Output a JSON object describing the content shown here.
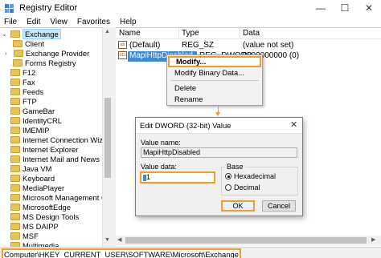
{
  "window": {
    "title": "Registry Editor",
    "minimize": "—",
    "maximize": "☐",
    "close": "✕"
  },
  "menu": [
    "File",
    "Edit",
    "View",
    "Favorites",
    "Help"
  ],
  "tree": {
    "selected": "Exchange",
    "children": [
      "Client",
      "Exchange Provider",
      "Forms Registry"
    ],
    "siblings": [
      "F12",
      "Fax",
      "Feeds",
      "FTP",
      "GameBar",
      "IdentityCRL",
      "IMEMIP",
      "Internet Connection Wizard",
      "Internet Explorer",
      "Internet Mail and News",
      "Java VM",
      "Keyboard",
      "MediaPlayer",
      "Microsoft Management Console",
      "MicrosoftEdge",
      "MS Design Tools",
      "MS DAIPP",
      "MSF",
      "Multimedia"
    ]
  },
  "list": {
    "columns": [
      "Name",
      "Type",
      "Data"
    ],
    "rows": [
      {
        "icon": "string-value-icon",
        "name": "(Default)",
        "type": "REG_SZ",
        "data": "(value not set)"
      },
      {
        "icon": "dword-value-icon",
        "name": "MapiHttpDisabled",
        "type": "REG_DWORD",
        "data": "0x00000000 (0)"
      }
    ]
  },
  "context_menu": {
    "items": [
      "Modify...",
      "Modify Binary Data...",
      "Delete",
      "Rename"
    ]
  },
  "dialog": {
    "title": "Edit DWORD (32-bit) Value",
    "close": "✕",
    "value_name_label": "Value name:",
    "value_name": "MapiHttpDisabled",
    "value_data_label": "Value data:",
    "value_data": "1",
    "base_label": "Base",
    "base_options": [
      "Hexadecimal",
      "Decimal"
    ],
    "base_selected": "Hexadecimal",
    "ok_label": "OK",
    "cancel_label": "Cancel"
  },
  "status": {
    "path": "Computer\\HKEY_CURRENT_USER\\SOFTWARE\\Microsoft\\Exchange"
  },
  "colors": {
    "highlight_orange": "#f39c2b",
    "selection_blue": "#3b8bd6",
    "folder_yellow": "#e8c35a"
  }
}
